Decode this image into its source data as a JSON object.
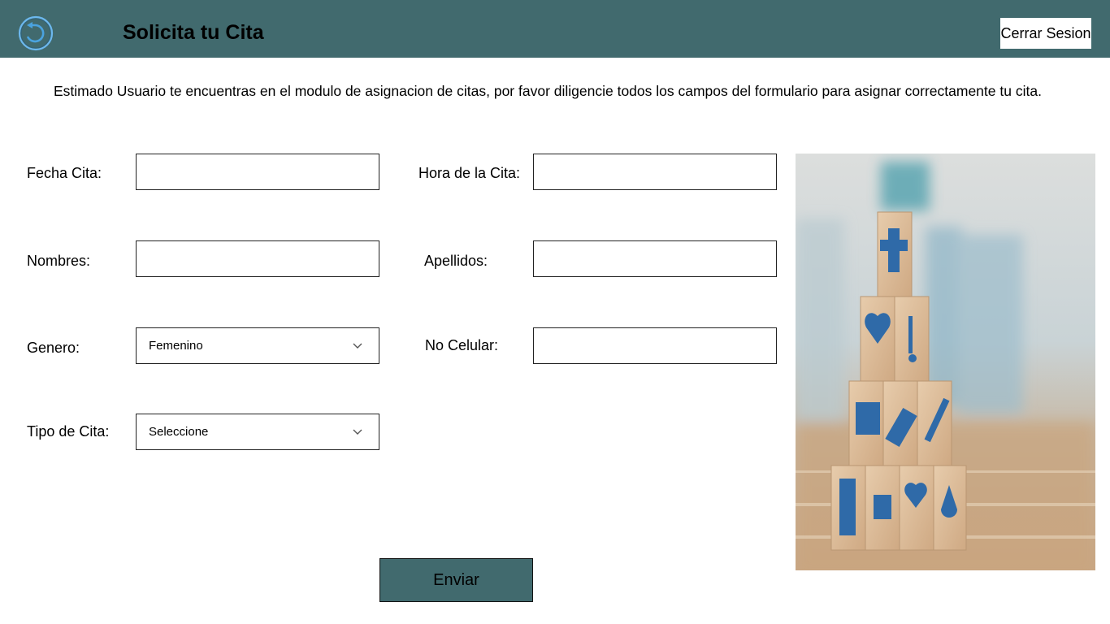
{
  "header": {
    "title": "Solicita tu Cita",
    "back_icon": "back-arrow-icon",
    "logout_label": "Cerrar Sesion"
  },
  "intro": {
    "text": "Estimado Usuario te encuentras en el modulo de asignacion de citas, por favor diligencie todos los campos del formulario para asignar correctamente tu cita."
  },
  "form": {
    "fecha_cita": {
      "label": "Fecha Cita:",
      "value": ""
    },
    "hora_cita": {
      "label": "Hora de la Cita:",
      "value": ""
    },
    "nombres": {
      "label": "Nombres:",
      "value": ""
    },
    "apellidos": {
      "label": "Apellidos:",
      "value": ""
    },
    "genero": {
      "label": "Genero:",
      "value": "Femenino"
    },
    "celular": {
      "label": "No Celular:",
      "value": ""
    },
    "tipo_cita": {
      "label": "Tipo de Cita:",
      "value": "Seleccione"
    },
    "submit_label": "Enviar"
  },
  "colors": {
    "header_bg": "#416a6e",
    "button_bg": "#416a6e",
    "back_icon": "#4aa3df"
  },
  "image": {
    "description_icon": "medical-blocks-photo"
  }
}
